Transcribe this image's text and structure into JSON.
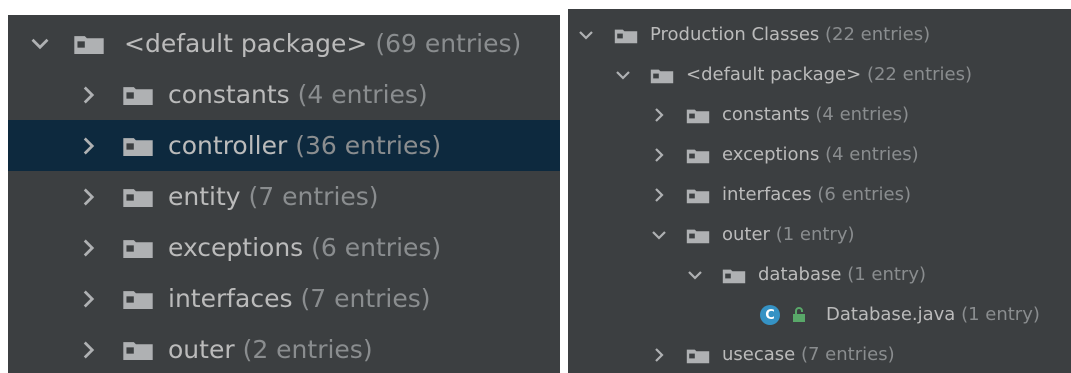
{
  "colors": {
    "panel_bg": "#3c3f41",
    "selected_bg": "#0d293e",
    "text": "#bbbbbb",
    "muted_text": "#8a8d8f",
    "folder_icon": "#afb1b3",
    "class_icon": "#3592c4",
    "access_icon": "#59a869"
  },
  "left_tree": {
    "root": {
      "name": "<default package>",
      "count": "(69 entries)",
      "expanded": true,
      "icon": "folder-icon"
    },
    "items": [
      {
        "name": "constants",
        "count": "(4 entries)",
        "selected": false,
        "icon": "folder-icon"
      },
      {
        "name": "controller",
        "count": "(36 entries)",
        "selected": true,
        "icon": "folder-icon"
      },
      {
        "name": "entity",
        "count": "(7 entries)",
        "selected": false,
        "icon": "folder-icon"
      },
      {
        "name": "exceptions",
        "count": "(6 entries)",
        "selected": false,
        "icon": "folder-icon"
      },
      {
        "name": "interfaces",
        "count": "(7 entries)",
        "selected": false,
        "icon": "folder-icon"
      },
      {
        "name": "outer",
        "count": "(2 entries)",
        "selected": false,
        "icon": "folder-icon"
      }
    ]
  },
  "right_tree": {
    "root": {
      "name": "Production Classes",
      "count": "(22 entries)",
      "expanded": true,
      "icon": "folder-icon"
    },
    "package": {
      "name": "<default package>",
      "count": "(22 entries)",
      "expanded": true,
      "icon": "folder-icon"
    },
    "items": [
      {
        "name": "constants",
        "count": "(4 entries)",
        "icon": "folder-icon"
      },
      {
        "name": "exceptions",
        "count": "(4 entries)",
        "icon": "folder-icon"
      },
      {
        "name": "interfaces",
        "count": "(6 entries)",
        "icon": "folder-icon"
      }
    ],
    "outer": {
      "name": "outer",
      "count": "(1 entry)",
      "expanded": true,
      "icon": "folder-icon"
    },
    "database": {
      "name": "database",
      "count": "(1 entry)",
      "expanded": true,
      "icon": "folder-icon"
    },
    "file": {
      "name": "Database.java",
      "count": "(1 entry)",
      "class_letter": "C",
      "icon": "class-icon",
      "access_icon": "lock-open-icon"
    },
    "usecase": {
      "name": "usecase",
      "count": "(7 entries)",
      "icon": "folder-icon"
    }
  }
}
